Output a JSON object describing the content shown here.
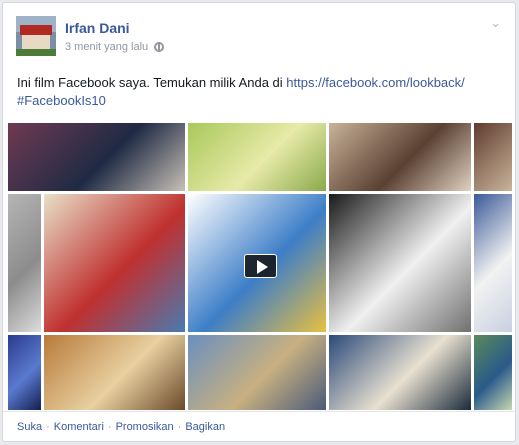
{
  "post": {
    "author": "Irfan Dani",
    "timestamp": "3 menit yang lalu",
    "privacy_icon": "globe-icon",
    "menu_icon": "chevron-down-icon",
    "text_prefix": "Ini film Facebook saya. Temukan milik Anda di ",
    "link": "https://facebook.com/lookback/",
    "hashtag": "#FacebookIs10"
  },
  "collage": {
    "tiles": [
      {
        "desc": "group-photo",
        "colors": [
          "#6f3a52",
          "#1f2a44",
          "#c8c0b6"
        ]
      },
      {
        "desc": "green-document",
        "colors": [
          "#a9c85a",
          "#e7eaa8",
          "#8aa94a"
        ]
      },
      {
        "desc": "selfie",
        "colors": [
          "#c9b39a",
          "#5a4032",
          "#e0d2c0"
        ]
      },
      {
        "desc": "edge-photo",
        "colors": [
          "#5e3a2e",
          "#9a7f6a",
          "#c9b39a"
        ]
      },
      {
        "desc": "wall-photo",
        "colors": [
          "#b5b5b5",
          "#8c8c8c",
          "#dcdcdc"
        ]
      },
      {
        "desc": "pesta-budaya-poster",
        "colors": [
          "#e8e0c8",
          "#c03030",
          "#4a7ab0"
        ]
      },
      {
        "desc": "cartoon-reader",
        "colors": [
          "#ffffff",
          "#3d7ec8",
          "#e8c040"
        ]
      },
      {
        "desc": "bw-portrait",
        "colors": [
          "#1a1a1a",
          "#f0f0f0",
          "#707070"
        ]
      },
      {
        "desc": "web-page",
        "colors": [
          "#3b5998",
          "#f2f2f2",
          "#c8d0e0"
        ]
      },
      {
        "desc": "blue-cells",
        "colors": [
          "#2a3b8c",
          "#5a7ad0",
          "#141e50"
        ]
      },
      {
        "desc": "comic-panels",
        "colors": [
          "#b87a3a",
          "#e8d0a0",
          "#6a4a2a"
        ]
      },
      {
        "desc": "mosque-greeting",
        "colors": [
          "#6a8fc0",
          "#c8b080",
          "#4a5a7a"
        ]
      },
      {
        "desc": "book-cover",
        "colors": [
          "#2a4a7a",
          "#e8e0d0",
          "#1a2a3a"
        ]
      },
      {
        "desc": "green-map",
        "colors": [
          "#5a8a5a",
          "#2a5a8a",
          "#c8d8b0"
        ]
      }
    ]
  },
  "actions": {
    "like": "Suka",
    "comment": "Komentari",
    "promote": "Promosikan",
    "share": "Bagikan",
    "separator": "·"
  }
}
